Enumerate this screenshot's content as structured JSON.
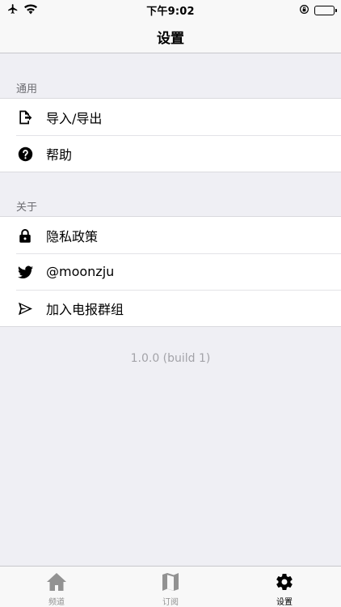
{
  "status_bar": {
    "time": "下午9:02",
    "left_icons": [
      "airplane-icon",
      "wifi-icon"
    ],
    "right_icons": [
      "orientation-lock-icon",
      "battery-icon"
    ]
  },
  "nav": {
    "title": "设置"
  },
  "sections": [
    {
      "header": "通用",
      "items": [
        {
          "label": "导入/导出",
          "icon": "import-export-icon"
        },
        {
          "label": "帮助",
          "icon": "help-icon"
        }
      ]
    },
    {
      "header": "关于",
      "items": [
        {
          "label": "隐私政策",
          "icon": "lock-icon"
        },
        {
          "label": "@moonzju",
          "icon": "twitter-icon"
        },
        {
          "label": "加入电报群组",
          "icon": "telegram-icon"
        }
      ]
    }
  ],
  "version": "1.0.0 (build 1)",
  "tab_bar": {
    "tabs": [
      {
        "label": "频道",
        "icon": "home-icon",
        "active": false
      },
      {
        "label": "订阅",
        "icon": "map-icon",
        "active": false
      },
      {
        "label": "设置",
        "icon": "gear-icon",
        "active": true
      }
    ],
    "active_color": "#000000",
    "inactive_color": "#929292"
  }
}
